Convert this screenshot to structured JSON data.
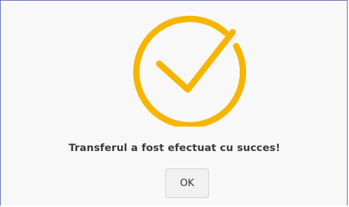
{
  "dialog": {
    "icon": "check-circle-icon",
    "accent_color": "#F7B500",
    "message": "Transferul a fost efectuat cu succes!",
    "ok_label": "OK"
  }
}
